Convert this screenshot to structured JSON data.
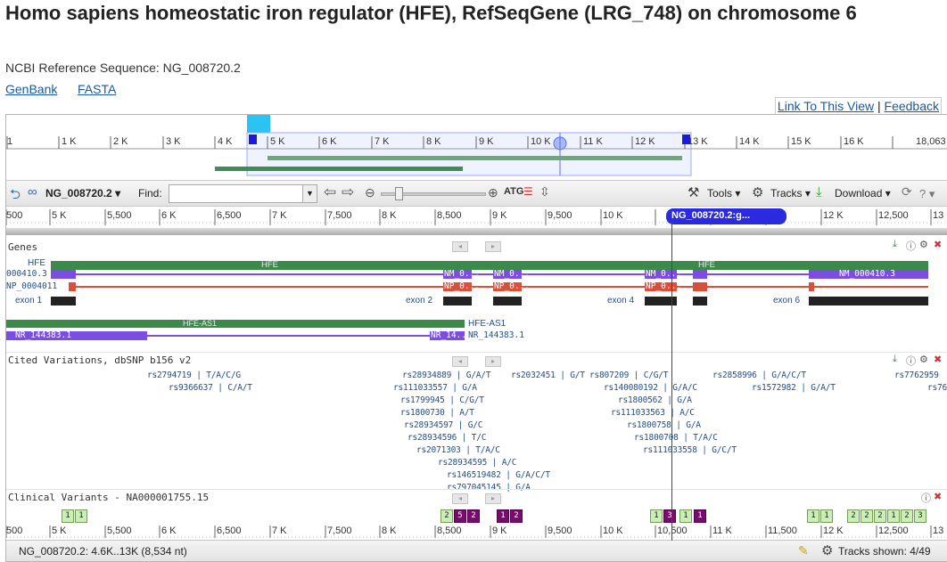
{
  "page": {
    "title": "Homo sapiens homeostatic iron regulator (HFE), RefSeqGene (LRG_748) on chromosome 6",
    "subtitle": "NCBI Reference Sequence: NG_008720.2",
    "links": [
      "GenBank",
      "FASTA"
    ],
    "view_links": {
      "link": "Link To This View",
      "sep": "|",
      "feedback": "Feedback"
    }
  },
  "overview": {
    "ticks": [
      "1",
      "1 K",
      "2 K",
      "3 K",
      "4 K",
      "5 K",
      "6 K",
      "7 K",
      "8 K",
      "9 K",
      "10 K",
      "11 K",
      "12 K",
      "13 K",
      "14 K",
      "15 K",
      "16 K",
      "18,063"
    ]
  },
  "toolbar": {
    "seq_id": "NG_008720.2",
    "find_label": "Find:",
    "find_value": "",
    "tools": "Tools",
    "tracks": "Tracks",
    "download": "Download",
    "help": "?"
  },
  "ruler": {
    "ticks": [
      "500",
      "5 K",
      "5,500",
      "6 K",
      "6,500",
      "7 K",
      "7,500",
      "8 K",
      "8,500",
      "9 K",
      "9,500",
      "10 K",
      "10,500",
      "11 K",
      "11,500",
      "12 K",
      "12,500",
      "13"
    ],
    "marker": "NG_008720.2:g..."
  },
  "genes_track": {
    "title": "Genes",
    "hfe_label": "HFE",
    "nm_left": "000410.3",
    "np_left": "NP_0004011",
    "exon1": "exon 1",
    "exon2": "exon 2",
    "exon4": "exon 4",
    "exon6": "exon 6",
    "nm_short": "NM_0...",
    "np_short": "NP_0...",
    "nm_right": "NM_000410.3",
    "hfe_as1": "HFE-AS1",
    "nr_left": "NR_144383.1",
    "nr_short": "NR_14...",
    "nr_right": "NR_144383.1"
  },
  "variations_track": {
    "title": "Cited Variations, dbSNP b156 v2",
    "snps": [
      "rs2794719 | T/A/C/G",
      "rs9366637 | C/A/T",
      "rs28934889 | G/A/T",
      "rs111033557 | G/A",
      "rs1799945 | C/G/T",
      "rs1800730 | A/T",
      "rs28934597 | G/C",
      "rs28934596 | T/C",
      "rs2071303 | T/A/C",
      "rs28934595 | A/C",
      "rs146519482 | G/A/C/T",
      "rs797045145 | G/A",
      "rs2032451 | G/T",
      "rs807209 | C/G/T",
      "rs140080192 | G/A/C",
      "rs1800562 | G/A",
      "rs111033563 | A/C",
      "rs1800758 | G/A",
      "rs1800708 | T/A/C",
      "rs111033558 | G/C/T",
      "rs2858996 | G/A/C/T",
      "rs1572982 | G/A/T",
      "rs7762959",
      "rs76"
    ]
  },
  "clinical_track": {
    "title": "Clinical Variants - NA000001755.15",
    "boxes": [
      "1",
      "1",
      "2",
      "5",
      "2",
      "1",
      "2",
      "1",
      "3",
      "1",
      "1",
      "1",
      "1",
      "2",
      "2",
      "2",
      "1",
      "2",
      "3"
    ]
  },
  "status": {
    "range": "NG_008720.2: 4.6K..13K (8,534 nt)",
    "tracks_shown": "Tracks shown: 4/49"
  },
  "colors": {
    "green": "#3b8a4a",
    "purple": "#7b4de0",
    "red": "#d9503a",
    "black": "#222222",
    "marker_blue": "#1a1adb"
  }
}
